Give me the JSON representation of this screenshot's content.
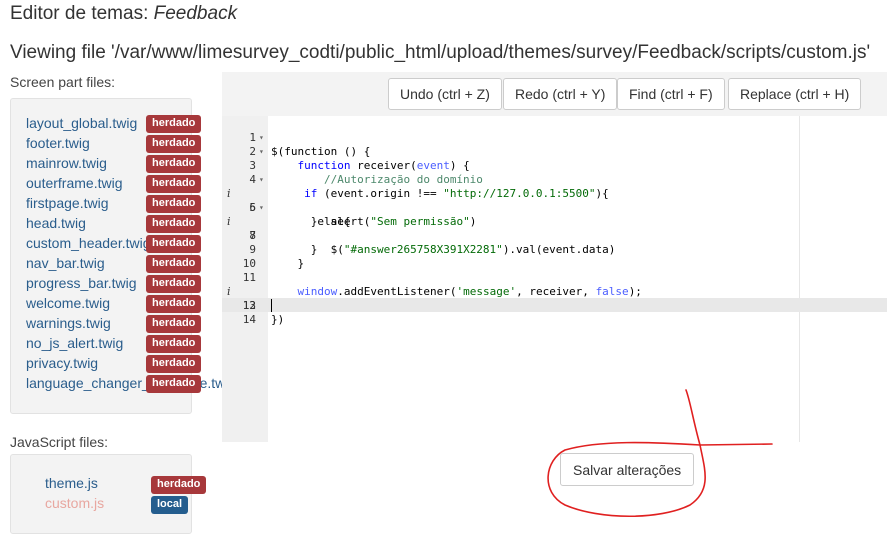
{
  "header": {
    "title_prefix": "Editor de temas:",
    "theme_name": "Feedback",
    "viewing_file": "Viewing file '/var/www/limesurvey_codti/public_html/upload/themes/survey/Feedback/scripts/custom.js'"
  },
  "screen_part": {
    "label": "Screen part files:",
    "files": [
      {
        "name": "layout_global.twig",
        "badge": "herdado"
      },
      {
        "name": "footer.twig",
        "badge": "herdado"
      },
      {
        "name": "mainrow.twig",
        "badge": "herdado"
      },
      {
        "name": "outerframe.twig",
        "badge": "herdado"
      },
      {
        "name": "firstpage.twig",
        "badge": "herdado"
      },
      {
        "name": "head.twig",
        "badge": "herdado"
      },
      {
        "name": "custom_header.twig",
        "badge": "herdado"
      },
      {
        "name": "nav_bar.twig",
        "badge": "herdado"
      },
      {
        "name": "progress_bar.twig",
        "badge": "herdado"
      },
      {
        "name": "welcome.twig",
        "badge": "herdado"
      },
      {
        "name": "warnings.twig",
        "badge": "herdado"
      },
      {
        "name": "no_js_alert.twig",
        "badge": "herdado"
      },
      {
        "name": "privacy.twig",
        "badge": "herdado"
      },
      {
        "name": "language_changer_language.twig",
        "badge": "herdado"
      }
    ]
  },
  "js_files": {
    "label": "JavaScript files:",
    "files": [
      {
        "name": "theme.js",
        "badge": "herdado",
        "color": "#2a5d8c"
      },
      {
        "name": "custom.js",
        "badge": "local",
        "color": "#e8a7a0"
      }
    ]
  },
  "toolbar": {
    "undo": "Undo (ctrl + Z)",
    "redo": "Redo (ctrl + Y)",
    "find": "Find (ctrl + F)",
    "replace": "Replace (ctrl + H)"
  },
  "editor": {
    "active_line": 14,
    "lines": [
      {
        "n": "1",
        "fold": true,
        "info": false
      },
      {
        "n": "2",
        "fold": true,
        "info": false
      },
      {
        "n": "3",
        "fold": false,
        "info": false
      },
      {
        "n": "4",
        "fold": true,
        "info": false
      },
      {
        "n": "5",
        "fold": false,
        "info": true
      },
      {
        "n": "6",
        "fold": true,
        "info": false
      },
      {
        "n": "7",
        "fold": false,
        "info": true
      },
      {
        "n": "8",
        "fold": false,
        "info": false
      },
      {
        "n": "9",
        "fold": false,
        "info": false
      },
      {
        "n": "10",
        "fold": false,
        "info": false
      },
      {
        "n": "11",
        "fold": false,
        "info": false
      },
      {
        "n": "12",
        "fold": false,
        "info": true
      },
      {
        "n": "13",
        "fold": false,
        "info": false
      },
      {
        "n": "14",
        "fold": false,
        "info": false
      }
    ],
    "code": {
      "l1": "$(function () {",
      "l2_kw": "function",
      "l2_rest": " receiver(",
      "l2_param": "event",
      "l2_end": ") {",
      "l3": "//Autorização do domínio",
      "l4_kw": "if",
      "l4_mid": " (event.origin !== ",
      "l4_str": "\"http://127.0.0.1:5500\"",
      "l4_end": "){",
      "l5_pre": "alert(",
      "l5_str": "\"Sem permissão\"",
      "l5_end": ")",
      "l6": "}else{",
      "l7_pre": "$(",
      "l7_str": "\"#answer265758X391X2281\"",
      "l7_end": ").val(event.data)",
      "l8": "}",
      "l9": "}",
      "l11_win": "window",
      "l11_mid": ".addEventListener(",
      "l11_str": "'message'",
      "l11_mid2": ", receiver, ",
      "l11_false": "false",
      "l11_end": ");",
      "l12": "})"
    }
  },
  "save_button": "Salvar alterações",
  "colors": {
    "badge_herdado": "#a7383b",
    "badge_local": "#245d8e",
    "link": "#2a5d8c",
    "scribble": "#e02020"
  }
}
